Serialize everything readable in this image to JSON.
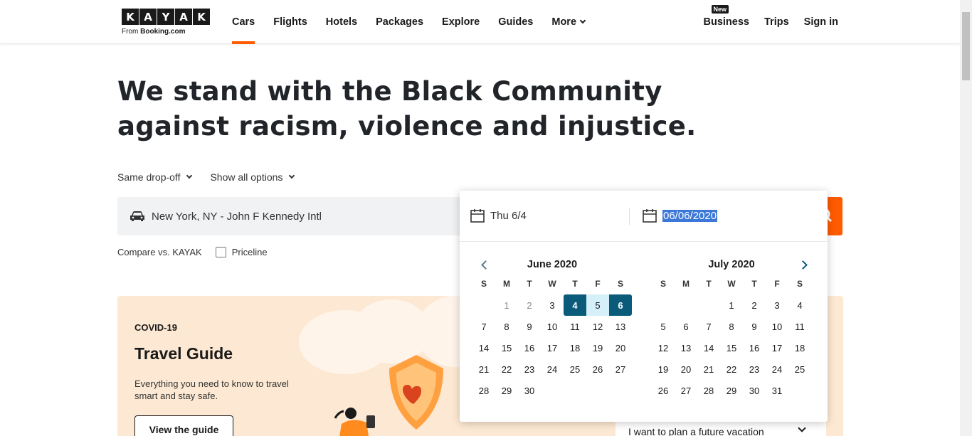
{
  "header": {
    "logo_letters": [
      "K",
      "A",
      "Y",
      "A",
      "K"
    ],
    "logo_from": "From",
    "logo_brand": "Booking.com",
    "nav": [
      {
        "label": "Cars",
        "active": true
      },
      {
        "label": "Flights"
      },
      {
        "label": "Hotels"
      },
      {
        "label": "Packages"
      },
      {
        "label": "Explore"
      },
      {
        "label": "Guides"
      },
      {
        "label": "More"
      }
    ],
    "new_badge": "New",
    "business": "Business",
    "trips": "Trips",
    "sign_in": "Sign in"
  },
  "headline": "We stand with the Black Community against racism, violence and injustice.",
  "options": {
    "dropoff": "Same drop-off",
    "show_all": "Show all options"
  },
  "search": {
    "location": "New York, NY - John F Kennedy Intl",
    "car_icon": "car-icon",
    "search_icon": "search-icon"
  },
  "compare": {
    "label": "Compare vs. KAYAK",
    "priceline": "Priceline"
  },
  "covid": {
    "label": "COVID-19",
    "title": "Travel Guide",
    "desc": "Everything you need to know to travel smart and stay safe.",
    "button": "View the guide",
    "plan": "I want to plan a future vacation"
  },
  "datepicker": {
    "start_date": "Thu 6/4",
    "end_date": "06/06/2020",
    "weekdays": [
      "S",
      "M",
      "T",
      "W",
      "T",
      "F",
      "S"
    ],
    "months": [
      {
        "title": "June 2020",
        "days": [
          "",
          "1",
          "2",
          "3",
          "4",
          "5",
          "6",
          "7",
          "8",
          "9",
          "10",
          "11",
          "12",
          "13",
          "14",
          "15",
          "16",
          "17",
          "18",
          "19",
          "20",
          "21",
          "22",
          "23",
          "24",
          "25",
          "26",
          "27",
          "28",
          "29",
          "30"
        ]
      },
      {
        "title": "July 2020",
        "days": [
          "",
          "",
          "",
          "1",
          "2",
          "3",
          "4",
          "5",
          "6",
          "7",
          "8",
          "9",
          "10",
          "11",
          "12",
          "13",
          "14",
          "15",
          "16",
          "17",
          "18",
          "19",
          "20",
          "21",
          "22",
          "23",
          "24",
          "25",
          "26",
          "27",
          "28",
          "29",
          "30",
          "31"
        ]
      }
    ],
    "selected_start": "4",
    "selected_end": "6",
    "in_range": [
      "5"
    ],
    "past_days": [
      "1",
      "2"
    ],
    "colors": {
      "selected": "#0a5a7a",
      "range": "#d6f0f9",
      "accent": "#ff5b00"
    }
  }
}
